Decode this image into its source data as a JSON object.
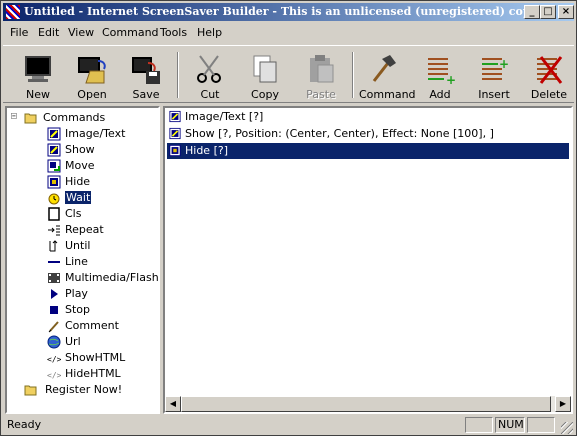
{
  "window": {
    "title": "Untitled - Internet ScreenSaver Builder - This is an unlicensed (unregistered) copy",
    "minimize": "_",
    "maximize": "□",
    "close": "×"
  },
  "menu": [
    "File",
    "Edit",
    "View",
    "Command",
    "Tools",
    "Help"
  ],
  "toolbar": {
    "new": "New",
    "open": "Open",
    "save": "Save",
    "cut": "Cut",
    "copy": "Copy",
    "paste": "Paste",
    "command": "Command",
    "add": "Add",
    "insert": "Insert",
    "delete": "Delete"
  },
  "tree": {
    "root_label": "Commands",
    "items": [
      {
        "label": "Image/Text",
        "icon": "image-text-icon"
      },
      {
        "label": "Show",
        "icon": "show-icon"
      },
      {
        "label": "Move",
        "icon": "move-icon"
      },
      {
        "label": "Hide",
        "icon": "hide-icon"
      },
      {
        "label": "Wait",
        "icon": "wait-icon"
      },
      {
        "label": "Cls",
        "icon": "cls-icon"
      },
      {
        "label": "Repeat",
        "icon": "repeat-icon"
      },
      {
        "label": "Until",
        "icon": "until-icon"
      },
      {
        "label": "Line",
        "icon": "line-icon"
      },
      {
        "label": "Multimedia/Flash",
        "icon": "multimedia-icon"
      },
      {
        "label": "Play",
        "icon": "play-icon"
      },
      {
        "label": "Stop",
        "icon": "stop-icon"
      },
      {
        "label": "Comment",
        "icon": "comment-icon"
      },
      {
        "label": "Url",
        "icon": "url-icon"
      },
      {
        "label": "ShowHTML",
        "icon": "showhtml-icon"
      },
      {
        "label": "HideHTML",
        "icon": "hidehtml-icon"
      }
    ],
    "selected": "Wait",
    "register_label": "Register Now!"
  },
  "commands": [
    {
      "text": "Image/Text [?]",
      "icon": "image-text-icon"
    },
    {
      "text": "Show [?, Position: (Center, Center), Effect: None [100], ]",
      "icon": "show-icon"
    },
    {
      "text": "Hide [?]",
      "icon": "hide-icon"
    }
  ],
  "status": {
    "text": "Ready",
    "num": "NUM"
  },
  "colors": {
    "title_start": "#0a246a",
    "title_end": "#a6caf0",
    "selection": "#0a246a",
    "face": "#d4d0c8"
  }
}
